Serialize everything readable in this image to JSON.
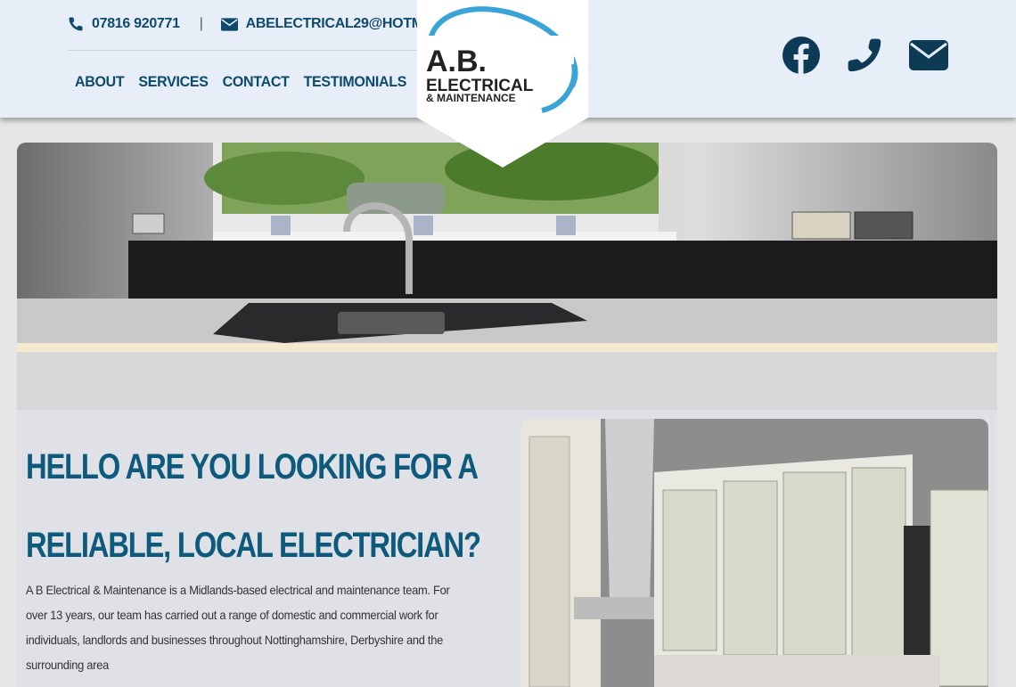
{
  "topbar": {
    "phone": "07816 920771",
    "separator": "|",
    "email": "ABELECTRICAL29@HOTMAIL.COM"
  },
  "nav": {
    "items": [
      "ABOUT",
      "SERVICES",
      "CONTACT",
      "TESTIMONIALS"
    ]
  },
  "logo": {
    "line1": "A.B.",
    "line2": "ELECTRICAL",
    "line3": "& MAINTENANCE"
  },
  "social": {
    "icons": [
      "facebook-icon",
      "phone-icon",
      "envelope-icon"
    ]
  },
  "hero": {
    "image": "kitchen-sink-photo"
  },
  "main": {
    "heading_line1": "HELLO ARE YOU LOOKING FOR A",
    "heading_line2": "RELIABLE, LOCAL ELECTRICIAN?",
    "paragraph_line1": "A B Electrical & Maintenance is a Midlands-based electrical and maintenance team. For",
    "paragraph_line2": "over 13 years, our team has carried out a range of domestic and commercial work for",
    "paragraph_line3": "individuals, landlords and businesses throughout Nottinghamshire, Derbyshire and the",
    "paragraph_line4": "surrounding area"
  },
  "colors": {
    "brand_blue": "#0d4a6b",
    "heading_blue": "#0d5a7c",
    "header_bg": "#e7eef7",
    "logo_swoosh": "#3aa3d8"
  }
}
